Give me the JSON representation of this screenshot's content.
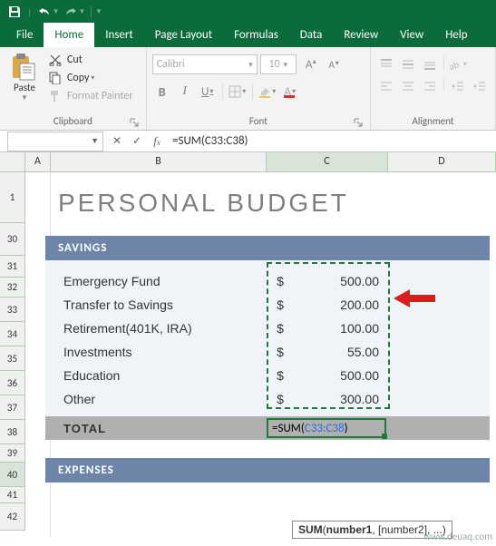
{
  "qa": {
    "save": "save-icon",
    "undo": "undo-icon",
    "redo": "redo-icon"
  },
  "tabs": {
    "file": "File",
    "home": "Home",
    "insert": "Insert",
    "page_layout": "Page Layout",
    "formulas": "Formulas",
    "data": "Data",
    "review": "Review",
    "view": "View",
    "help": "Help"
  },
  "ribbon": {
    "clipboard": {
      "paste": "Paste",
      "cut": "Cut",
      "copy": "Copy",
      "format_painter": "Format Painter",
      "group": "Clipboard"
    },
    "font": {
      "name": "Calibri",
      "size": "10",
      "b": "B",
      "i": "I",
      "u": "U",
      "group": "Font"
    },
    "alignment": {
      "group": "Alignment"
    }
  },
  "namebox": "",
  "formula_bar": "=SUM(C33:C38)",
  "columns": {
    "A": "A",
    "B": "B",
    "C": "C",
    "D": "D"
  },
  "rows": [
    "1",
    "30",
    "31",
    "32",
    "33",
    "34",
    "35",
    "36",
    "37",
    "38",
    "39",
    "40",
    "41",
    "42"
  ],
  "sheet": {
    "title": "PERSONAL BUDGET",
    "section1": "SAVINGS",
    "items": [
      {
        "label": "Emergency Fund",
        "cur": "$",
        "val": "500.00"
      },
      {
        "label": "Transfer to Savings",
        "cur": "$",
        "val": "200.00"
      },
      {
        "label": "Retirement(401K, IRA)",
        "cur": "$",
        "val": "100.00"
      },
      {
        "label": "Investments",
        "cur": "$",
        "val": "55.00"
      },
      {
        "label": "Education",
        "cur": "$",
        "val": "500.00"
      },
      {
        "label": "Other",
        "cur": "$",
        "val": "300.00"
      }
    ],
    "total_label": "TOTAL",
    "total_formula_prefix": "=SUM(",
    "total_formula_ref": "C33:C38",
    "total_formula_suffix": ")",
    "section2": "EXPENSES"
  },
  "tooltip": {
    "fn": "SUM",
    "sig": "(number1, [number2], ...)"
  },
  "watermark": "www.deuaq.com"
}
